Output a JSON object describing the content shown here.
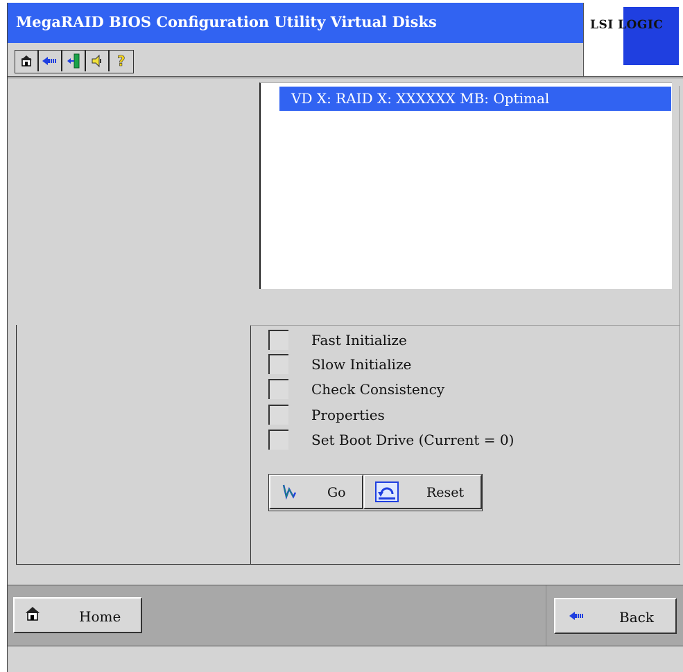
{
  "window": {
    "title": "MegaRAID BIOS Configuration Utility Virtual Disks",
    "logo_text": "LSI LOGIC"
  },
  "toolbar": {
    "buttons": [
      {
        "icon": "home-icon"
      },
      {
        "icon": "back-arrow-icon"
      },
      {
        "icon": "exit-door-icon"
      },
      {
        "icon": "speaker-icon"
      },
      {
        "icon": "help-icon"
      }
    ]
  },
  "virtual_disks": {
    "items": [
      {
        "label": "VD X: RAID X: XXXXXX MB: Optimal",
        "selected": true
      }
    ]
  },
  "options": {
    "items": [
      {
        "label": "Fast Initialize",
        "checked": false
      },
      {
        "label": "Slow Initialize",
        "checked": false
      },
      {
        "label": "Check Consistency",
        "checked": false
      },
      {
        "label": "Properties",
        "checked": false
      },
      {
        "label": "Set Boot Drive (Current = 0)",
        "checked": false
      }
    ]
  },
  "actions": {
    "go_label": "Go",
    "reset_label": "Reset"
  },
  "navigation": {
    "home_label": "Home",
    "back_label": "Back"
  },
  "colors": {
    "title_bar": "#3163f2",
    "selection": "#3163f2",
    "logo_blue": "#1f3fe0",
    "panel": "#d4d4d4"
  }
}
